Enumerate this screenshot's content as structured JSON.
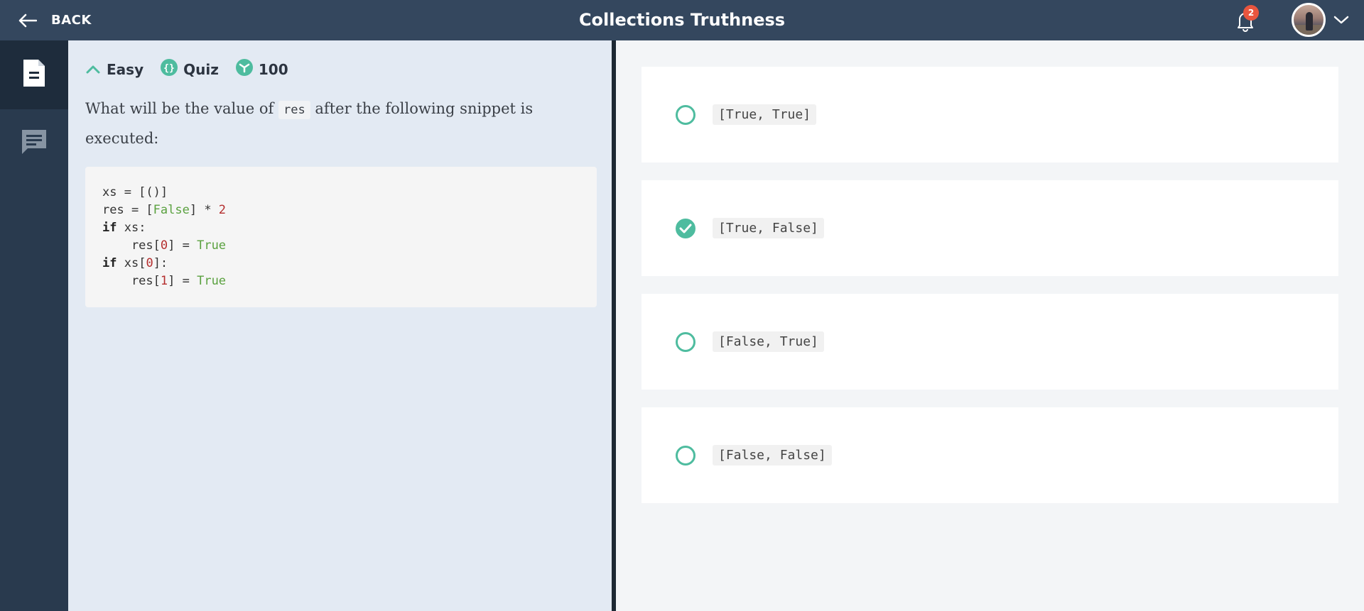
{
  "topbar": {
    "back_label": "BACK",
    "title": "Collections Truthness",
    "notification_count": "2",
    "icons": [
      "arrow-left-icon",
      "bell-icon",
      "chevron-down-icon"
    ]
  },
  "rail": {
    "items": [
      {
        "name": "document",
        "icon": "document-icon",
        "active": true
      },
      {
        "name": "comments",
        "icon": "comment-icon",
        "active": false
      }
    ]
  },
  "question": {
    "difficulty": "Easy",
    "type": "Quiz",
    "points": "100",
    "text_before": "What will be the value of",
    "inline_code": "res",
    "text_after": "after the following snippet is executed:"
  },
  "code": {
    "lines": [
      "xs = [()]",
      "res = [False] * 2",
      "if xs:",
      "    res[0] = True",
      "if xs[0]:",
      "    res[1] = True"
    ]
  },
  "options": [
    {
      "label": "[True, True]",
      "selected": false
    },
    {
      "label": "[True, False]",
      "selected": true
    },
    {
      "label": "[False, True]",
      "selected": false
    },
    {
      "label": "[False, False]",
      "selected": false
    }
  ],
  "colors": {
    "topbar": "#34475e",
    "rail": "#293a4e",
    "accent": "#4ebc9f",
    "badge": "#e8553e"
  }
}
